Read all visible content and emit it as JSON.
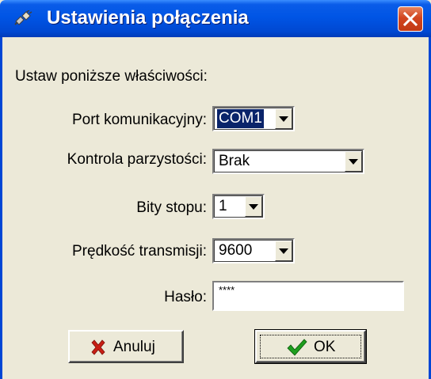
{
  "window": {
    "title": "Ustawienia połączenia",
    "title_icon": "plug-connection-icon",
    "close_icon": "close-icon"
  },
  "form": {
    "intro": "Ustaw poniższe właściwości:",
    "port": {
      "label": "Port komunikacyjny:",
      "value": "COM1"
    },
    "parity": {
      "label": "Kontrola parzystości:",
      "value": "Brak"
    },
    "stop_bits": {
      "label": "Bity stopu:",
      "value": "1"
    },
    "baud": {
      "label": "Prędkość transmisji:",
      "value": "9600"
    },
    "password": {
      "label": "Hasło:",
      "value": "****"
    }
  },
  "buttons": {
    "cancel": {
      "label": "Anuluj",
      "icon": "red-x-icon"
    },
    "ok": {
      "label": "OK",
      "icon": "green-check-icon"
    }
  },
  "colors": {
    "titlebar": "#0055E5",
    "close": "#D2451F",
    "face": "#ECE9D8",
    "selection": "#0A246A"
  }
}
